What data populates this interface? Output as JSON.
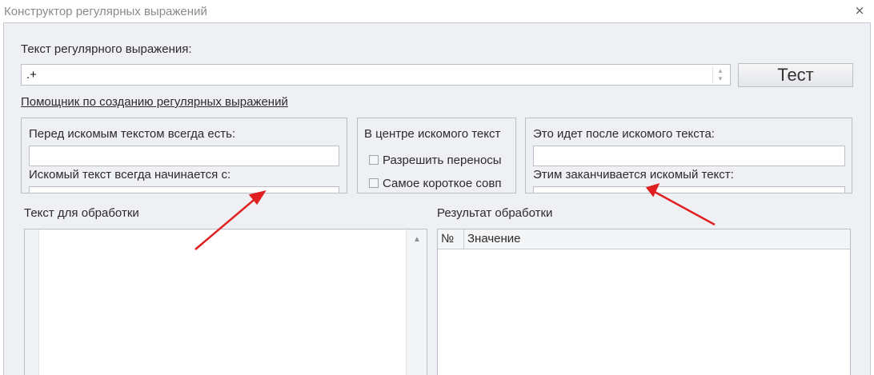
{
  "window": {
    "title": "Конструктор регулярных выражений",
    "close_glyph": "⨯"
  },
  "regex": {
    "label": "Текст регулярного выражения:",
    "value": ".+",
    "test_button": "Тест"
  },
  "helper": {
    "link": "Помощник по созданию регулярных выражений",
    "before_group": {
      "label_before": "Перед искомым текстом всегда есть:",
      "value_before": "",
      "label_starts": "Искомый текст всегда начинается с:"
    },
    "center_group": {
      "label": "В центре искомого текст",
      "allow_wrap": "Разрешить переносы",
      "shortest_match": "Самое короткое совп"
    },
    "after_group": {
      "label_after": "Это идет после искомого текста:",
      "value_after": "",
      "label_ends": "Этим заканчивается искомый текст:"
    }
  },
  "input_text": {
    "label": "Текст для обработки",
    "value": ""
  },
  "result": {
    "label": "Результат обработки",
    "columns": [
      "№",
      "Значение"
    ],
    "rows": []
  },
  "colors": {
    "dialog_bg": "#eef0f4",
    "border": "#b9bec7",
    "annotation_arrow": "#e02020"
  }
}
